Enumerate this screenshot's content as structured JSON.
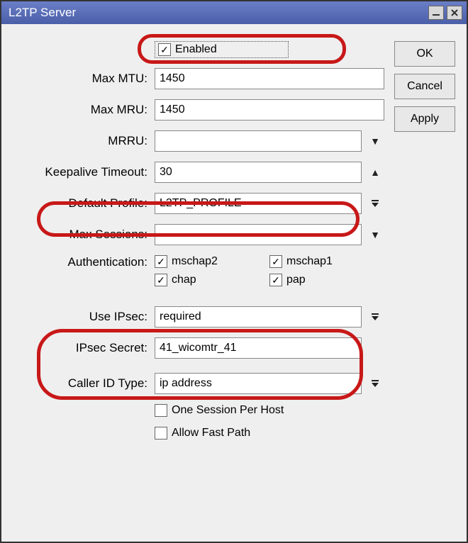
{
  "window": {
    "title": "L2TP Server"
  },
  "buttons": {
    "ok": "OK",
    "cancel": "Cancel",
    "apply": "Apply"
  },
  "fields": {
    "enabled": {
      "label": "Enabled",
      "checked": true
    },
    "max_mtu": {
      "label": "Max MTU:",
      "value": "1450"
    },
    "max_mru": {
      "label": "Max MRU:",
      "value": "1450"
    },
    "mrru": {
      "label": "MRRU:",
      "value": ""
    },
    "keepalive_timeout": {
      "label": "Keepalive Timeout:",
      "value": "30"
    },
    "default_profile": {
      "label": "Default Profile:",
      "value": "L2TP_PROFILE"
    },
    "max_sessions": {
      "label": "Max Sessions:",
      "value": ""
    },
    "authentication": {
      "label": "Authentication:",
      "mschap2": {
        "label": "mschap2",
        "checked": true
      },
      "mschap1": {
        "label": "mschap1",
        "checked": true
      },
      "chap": {
        "label": "chap",
        "checked": true
      },
      "pap": {
        "label": "pap",
        "checked": true
      }
    },
    "use_ipsec": {
      "label": "Use IPsec:",
      "value": "required"
    },
    "ipsec_secret": {
      "label": "IPsec Secret:",
      "value": "41_wicomtr_41"
    },
    "caller_id_type": {
      "label": "Caller ID Type:",
      "value": "ip address"
    },
    "one_session_per_host": {
      "label": "One Session Per Host",
      "checked": false
    },
    "allow_fast_path": {
      "label": "Allow Fast Path",
      "checked": false
    }
  },
  "icons": {
    "down_triangle": "▼",
    "up_triangle": "▲",
    "dropdown_bar": "⧩",
    "minimize": "▁",
    "close": "✕"
  }
}
